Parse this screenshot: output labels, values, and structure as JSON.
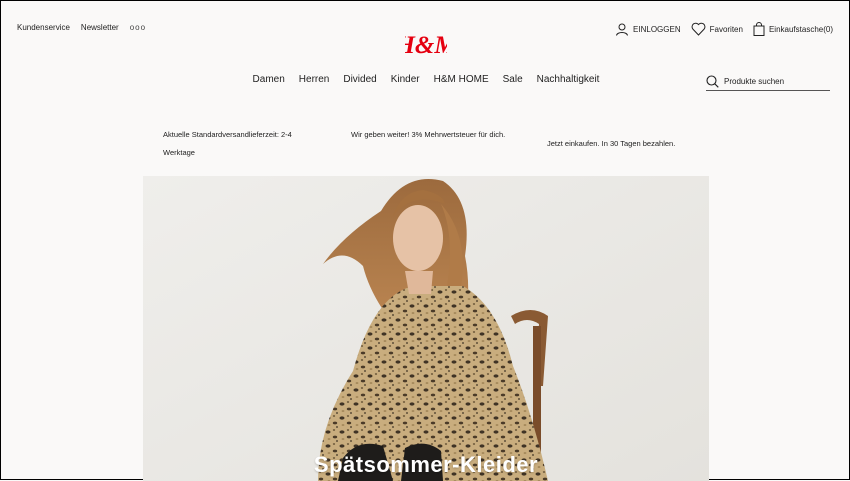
{
  "utility": {
    "customer_service": "Kundenservice",
    "newsletter": "Newsletter",
    "more": "ooo"
  },
  "brand": {
    "logo_text": "H&M",
    "color": "#e50010"
  },
  "account": {
    "login": "EINLOGGEN",
    "favorites": "Favoriten",
    "bag": "Einkaufstasche(0)"
  },
  "nav": {
    "items": [
      "Damen",
      "Herren",
      "Divided",
      "Kinder",
      "H&M HOME",
      "Sale",
      "Nachhaltigkeit"
    ]
  },
  "search": {
    "placeholder": "Produkte suchen"
  },
  "promos": [
    "Aktuelle Standardversandlieferzeit: 2-4 Werktage",
    "Wir geben weiter! 3% Mehrwertsteuer für dich.",
    "Jetzt einkaufen. In 30 Tagen bezahlen."
  ],
  "hero": {
    "title": "Spätsommer-Kleider"
  },
  "icons": [
    "user-icon",
    "heart-icon",
    "bag-icon",
    "search-icon"
  ]
}
